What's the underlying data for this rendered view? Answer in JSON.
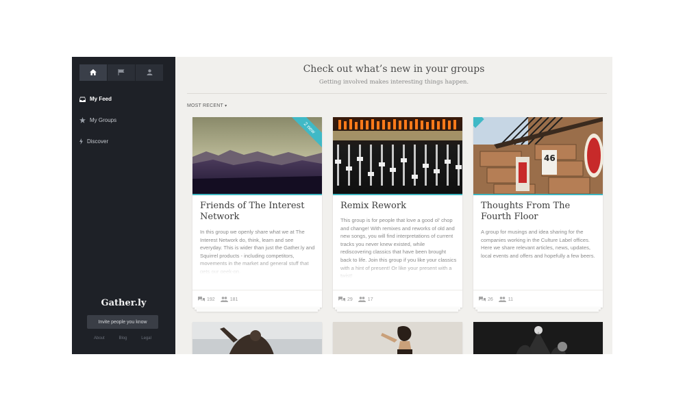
{
  "sidebar": {
    "top_tabs": [
      {
        "icon": "home-icon",
        "active": true
      },
      {
        "icon": "flag-icon",
        "active": false
      },
      {
        "icon": "user-icon",
        "active": false
      }
    ],
    "nav": [
      {
        "label": "My Feed",
        "icon": "inbox-icon",
        "active": true
      },
      {
        "label": "My Groups",
        "icon": "star-icon",
        "active": false
      },
      {
        "label": "Discover",
        "icon": "bolt-icon",
        "active": false
      }
    ],
    "brand": "Gather.ly",
    "invite_label": "Invite people you know",
    "footer_links": [
      "About",
      "Blog",
      "Legal"
    ]
  },
  "main": {
    "title": "Check out what’s new in your groups",
    "subtitle": "Getting involved makes interesting things happen.",
    "sort_label": "MOST RECENT"
  },
  "cards": [
    {
      "title": "Friends of The Interest Network",
      "description": "In this group we openly share what we at The Interest Network do, think, learn and see everyday. This is wider than just the Gather.ly and Squirrel products - including competitors, movements in the market and general stuff that gets our geek-on.",
      "comments": "192",
      "members": "181",
      "badge": "2 new",
      "image": "mountains-image"
    },
    {
      "title": "Remix Rework",
      "description": "This group is for people that love a good ol' chop and change! With remixes and reworks of old and new songs, you will find interpretations of current tracks you never knew existed, while rediscovering classics that have been brought back to life. Join this group if you like your classics with a hint of present! Or like your present with a twist!",
      "comments": "29",
      "members": "17",
      "badge": "",
      "image": "mixing-desk-image"
    },
    {
      "title": "Thoughts From The Fourth Floor",
      "description": "A group for musings and idea sharing for the companies working in the Culture Label offices. Here we share relevant articles, news, updates, local events and offers and hopefully a few beers.",
      "comments": "26",
      "members": "11",
      "badge": "",
      "image": "staircase-image"
    }
  ],
  "bottom_cards": [
    {
      "image": "ape-image"
    },
    {
      "image": "caveman-image"
    },
    {
      "image": "concert-image"
    }
  ],
  "colors": {
    "sidebar_bg": "#1e2127",
    "main_bg": "#f1f0ed",
    "accent": "#40b9c6"
  }
}
